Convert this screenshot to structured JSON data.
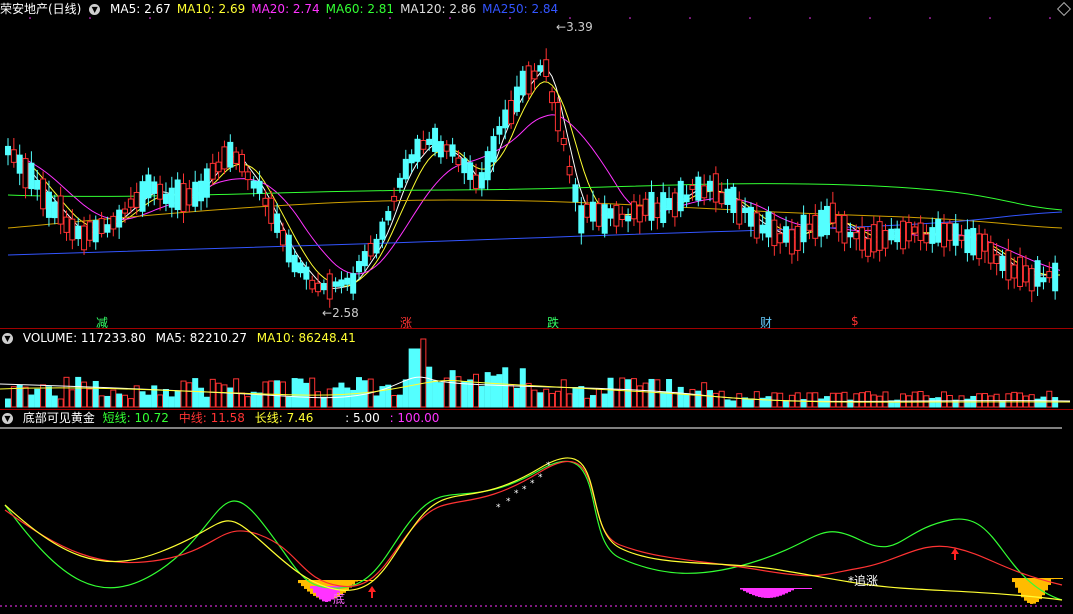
{
  "title": "荣安地产(日线)",
  "ma_header": [
    {
      "label": "MA5: 2.67",
      "color": "#ffffff"
    },
    {
      "label": "MA10: 2.69",
      "color": "#ffff33"
    },
    {
      "label": "MA20: 2.74",
      "color": "#ff33ff"
    },
    {
      "label": "MA60: 2.81",
      "color": "#33ff33"
    },
    {
      "label": "MA120: 2.86",
      "color": "#dddddd"
    },
    {
      "label": "MA250: 2.84",
      "color": "#3355ff"
    }
  ],
  "price_high_label": "3.39",
  "price_low_label": "2.58",
  "event_marks": [
    {
      "text": "减",
      "color": "#33ff66"
    },
    {
      "text": "涨",
      "color": "#ff3333"
    },
    {
      "text": "跌",
      "color": "#33ff66"
    },
    {
      "text": "财",
      "color": "#66ccff"
    },
    {
      "text": "$",
      "color": "#ff3333"
    }
  ],
  "volume_header": {
    "volume": "VOLUME: 117233.80",
    "ma5": "MA5: 82210.27",
    "ma10": "MA10: 86248.41"
  },
  "indicator_header": {
    "name": "底部可见黄金",
    "short": "短线: 10.72",
    "mid": "中线: 11.58",
    "long": "长线: 7.46",
    "level1": ": 5.00",
    "level2": ": 100.00"
  },
  "indicator_marks": {
    "bottom": "底",
    "chase": "追涨"
  },
  "colors": {
    "up": "#ff3333",
    "down": "#54ffff",
    "separator": "#a00000",
    "ma5": "#ffffff",
    "ma10": "#ffff33",
    "ma20": "#ff33ff",
    "ma60": "#33ff33",
    "ma120": "#dddddd",
    "ma250": "#3355ff"
  }
}
